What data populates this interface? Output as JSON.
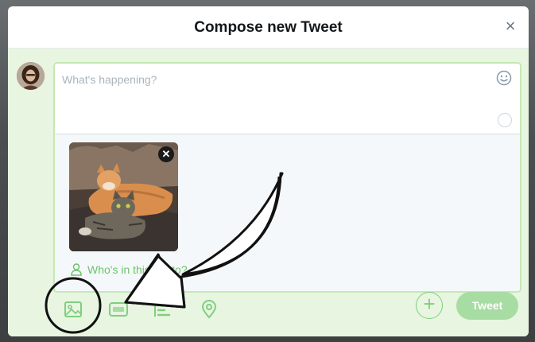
{
  "dialog": {
    "title": "Compose new Tweet",
    "close_symbol": "×"
  },
  "composer": {
    "placeholder": "What's happening?",
    "emoji_icon": "smiley-icon",
    "counter_icon": "character-counter-ring"
  },
  "media": {
    "photo_description_icon": "photo-cats-thumbnail",
    "remove_symbol": "✕",
    "tag_people_label": "Who's in this photo?"
  },
  "toolbar": {
    "icons": [
      "image-icon",
      "gif-icon",
      "poll-icon",
      "location-icon"
    ],
    "add_symbol": "+",
    "tweet_label": "Tweet"
  },
  "colors": {
    "accent_green": "#7fcf7f",
    "tweet_button": "#a7dca2",
    "composer_border": "#c6e8b4",
    "background_tint": "#e8f5e0"
  }
}
